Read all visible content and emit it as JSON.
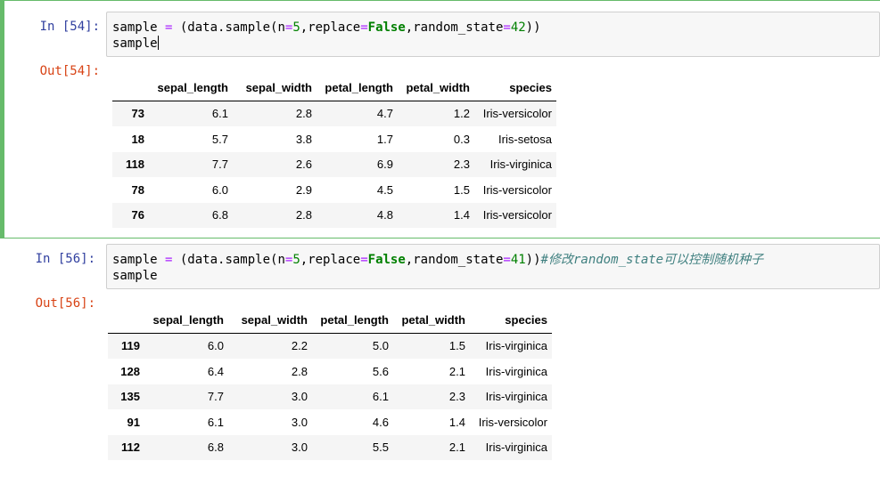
{
  "cells": [
    {
      "in_prompt": "In [54]:",
      "out_prompt": "Out[54]:",
      "code_line2": "sample",
      "table": {
        "columns": [
          "sepal_length",
          "sepal_width",
          "petal_length",
          "petal_width",
          "species"
        ],
        "rows": [
          {
            "index": "73",
            "sepal_length": "6.1",
            "sepal_width": "2.8",
            "petal_length": "4.7",
            "petal_width": "1.2",
            "species": "Iris-versicolor"
          },
          {
            "index": "18",
            "sepal_length": "5.7",
            "sepal_width": "3.8",
            "petal_length": "1.7",
            "petal_width": "0.3",
            "species": "Iris-setosa"
          },
          {
            "index": "118",
            "sepal_length": "7.7",
            "sepal_width": "2.6",
            "petal_length": "6.9",
            "petal_width": "2.3",
            "species": "Iris-virginica"
          },
          {
            "index": "78",
            "sepal_length": "6.0",
            "sepal_width": "2.9",
            "petal_length": "4.5",
            "petal_width": "1.5",
            "species": "Iris-versicolor"
          },
          {
            "index": "76",
            "sepal_length": "6.8",
            "sepal_width": "2.8",
            "petal_length": "4.8",
            "petal_width": "1.4",
            "species": "Iris-versicolor"
          }
        ]
      }
    },
    {
      "in_prompt": "In [56]:",
      "out_prompt": "Out[56]:",
      "code_line2": "sample",
      "table": {
        "columns": [
          "sepal_length",
          "sepal_width",
          "petal_length",
          "petal_width",
          "species"
        ],
        "rows": [
          {
            "index": "119",
            "sepal_length": "6.0",
            "sepal_width": "2.2",
            "petal_length": "5.0",
            "petal_width": "1.5",
            "species": "Iris-virginica"
          },
          {
            "index": "128",
            "sepal_length": "6.4",
            "sepal_width": "2.8",
            "petal_length": "5.6",
            "petal_width": "2.1",
            "species": "Iris-virginica"
          },
          {
            "index": "135",
            "sepal_length": "7.7",
            "sepal_width": "3.0",
            "petal_length": "6.1",
            "petal_width": "2.3",
            "species": "Iris-virginica"
          },
          {
            "index": "91",
            "sepal_length": "6.1",
            "sepal_width": "3.0",
            "petal_length": "4.6",
            "petal_width": "1.4",
            "species": "Iris-versicolor"
          },
          {
            "index": "112",
            "sepal_length": "6.8",
            "sepal_width": "3.0",
            "petal_length": "5.5",
            "petal_width": "2.1",
            "species": "Iris-virginica"
          }
        ]
      }
    }
  ],
  "code_tokens": {
    "lhs": "sample ",
    "eq": "=",
    "open": " (data.sample(n",
    "eq2": "=",
    "n_val": "5",
    "comma_replace": ",replace",
    "eq3": "=",
    "false_kw": "False",
    "comma_rs": ",random_state",
    "eq4": "=",
    "rs_val_1": "42",
    "rs_val_2": "41",
    "close": "))",
    "comment": "#修改random_state可以控制随机种子"
  },
  "colors": {
    "selected_border": "#66bb6a",
    "in_prompt": "#303f9f",
    "out_prompt": "#d84315",
    "keyword": "#008000",
    "comment": "#408080"
  }
}
